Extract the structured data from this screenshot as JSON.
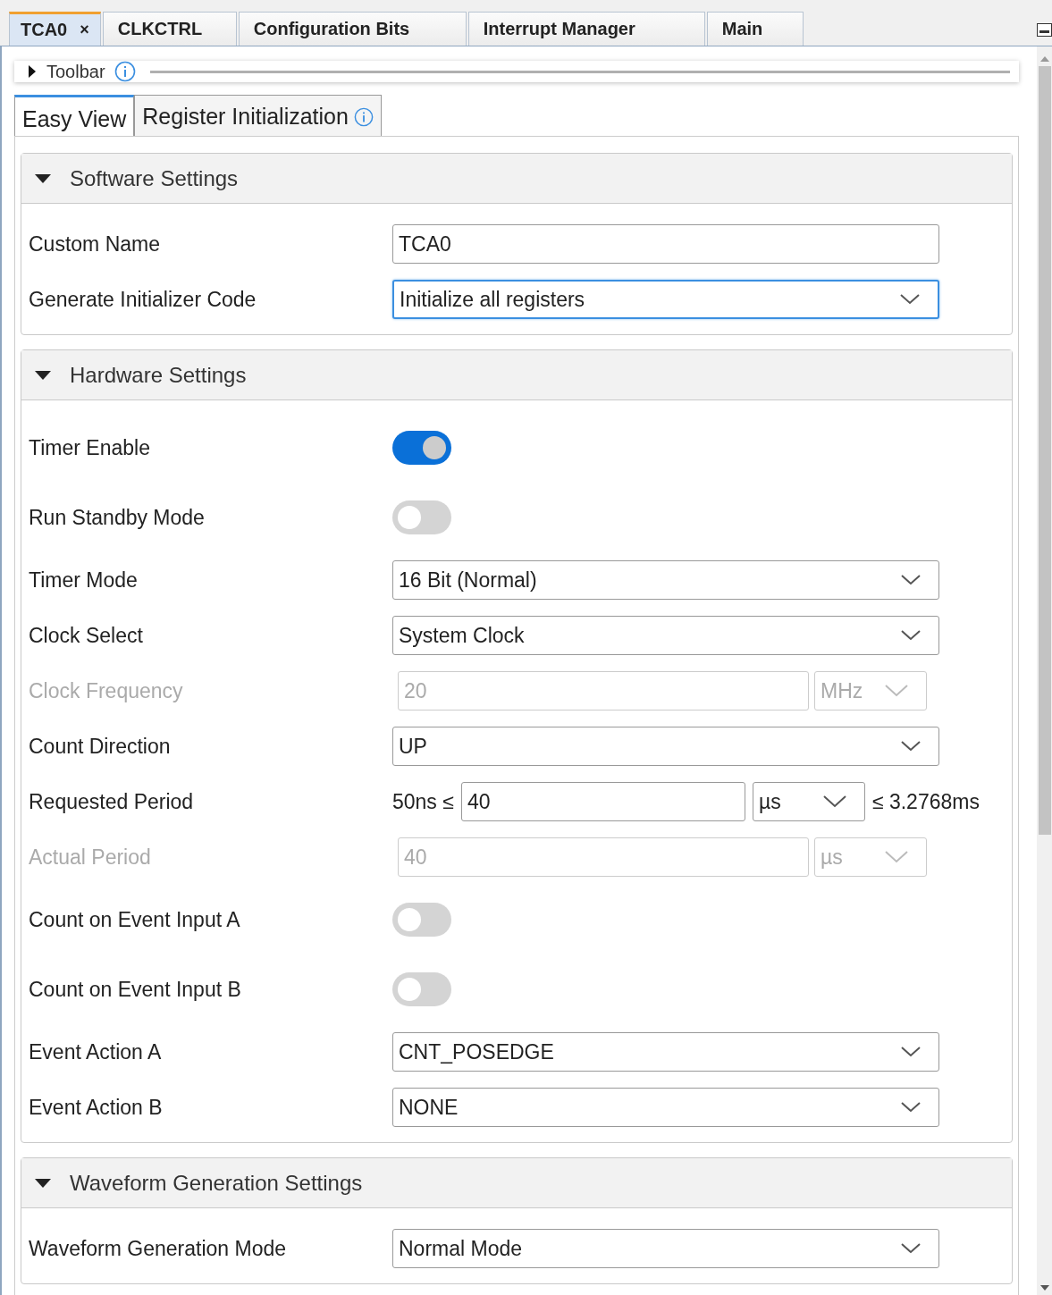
{
  "editor_tabs": [
    {
      "label": "TCA0",
      "selected": true,
      "closable": true
    },
    {
      "label": "CLKCTRL",
      "selected": false,
      "closable": false
    },
    {
      "label": "Configuration Bits",
      "selected": false,
      "closable": false
    },
    {
      "label": "Interrupt Manager",
      "selected": false,
      "closable": false
    },
    {
      "label": "Main",
      "selected": false,
      "closable": false
    }
  ],
  "close_glyph": "×",
  "toolbar": {
    "label": "Toolbar",
    "expanded": false
  },
  "view_tabs": [
    {
      "label": "Easy View",
      "selected": true,
      "info": false
    },
    {
      "label": "Register Initialization",
      "selected": false,
      "info": true
    }
  ],
  "sections": [
    {
      "title": "Software Settings",
      "expanded": true,
      "rows": [
        {
          "label": "Custom Name",
          "kind": "text",
          "value": "TCA0",
          "disabled": false
        },
        {
          "label": "Generate Initializer Code",
          "kind": "select",
          "value": "Initialize all registers",
          "disabled": false,
          "focused": true
        }
      ]
    },
    {
      "title": "Hardware Settings",
      "expanded": true,
      "rows": [
        {
          "label": "Timer Enable",
          "kind": "toggle",
          "on": true,
          "disabled": false
        },
        {
          "label": "Run Standby Mode",
          "kind": "toggle",
          "on": false,
          "disabled": false
        },
        {
          "label": "Timer Mode",
          "kind": "select",
          "value": "16 Bit (Normal)",
          "disabled": false,
          "focused": false
        },
        {
          "label": "Clock Select",
          "kind": "select",
          "value": "System Clock",
          "disabled": false,
          "focused": false
        },
        {
          "label": "Clock Frequency",
          "kind": "unit",
          "value": "20",
          "unit": "MHz",
          "disabled": true
        },
        {
          "label": "Count Direction",
          "kind": "select",
          "value": "UP",
          "disabled": false,
          "focused": false
        },
        {
          "label": "Requested Period",
          "kind": "range",
          "min": "50ns ≤",
          "value": "40",
          "unit": "µs",
          "max": "≤ 3.2768ms",
          "disabled": false
        },
        {
          "label": "Actual Period",
          "kind": "unit",
          "value": "40",
          "unit": "µs",
          "disabled": true
        },
        {
          "label": "Count on Event Input A",
          "kind": "toggle",
          "on": false,
          "disabled": false
        },
        {
          "label": "Count on Event Input B",
          "kind": "toggle",
          "on": false,
          "disabled": false
        },
        {
          "label": "Event Action A",
          "kind": "select",
          "value": "CNT_POSEDGE",
          "disabled": false,
          "focused": false
        },
        {
          "label": "Event Action B",
          "kind": "select",
          "value": "NONE",
          "disabled": false,
          "focused": false
        }
      ]
    },
    {
      "title": "Waveform Generation Settings",
      "expanded": true,
      "rows": [
        {
          "label": "Waveform Generation Mode",
          "kind": "select",
          "value": "Normal Mode",
          "disabled": false,
          "focused": false
        }
      ]
    }
  ]
}
